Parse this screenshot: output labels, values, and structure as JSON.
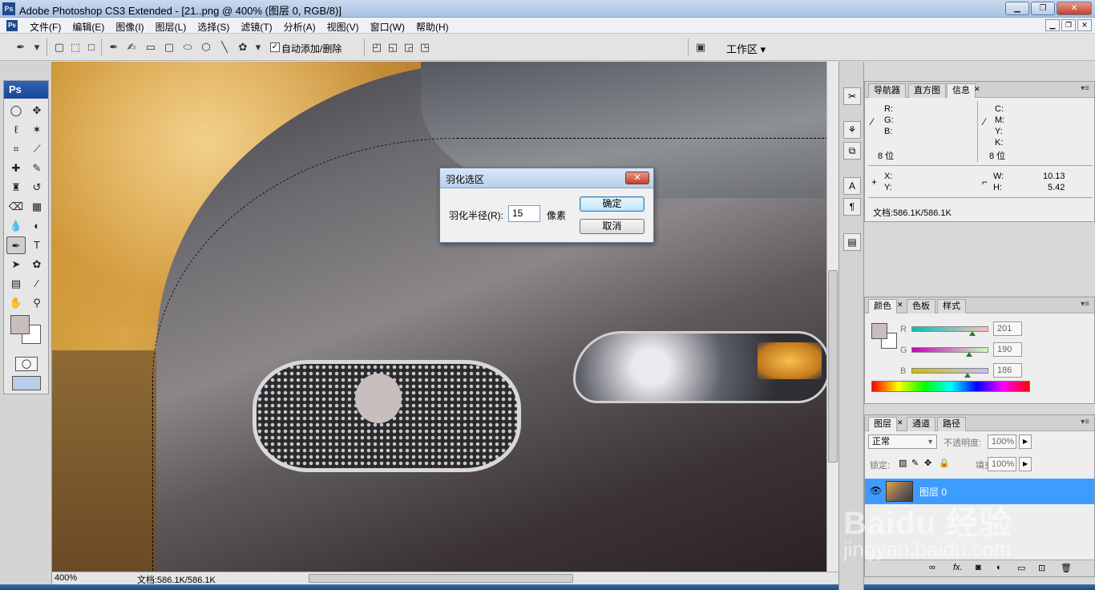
{
  "window": {
    "title": "Adobe Photoshop CS3 Extended - [21..png @ 400% (图层 0, RGB/8)]",
    "app_icon": "Ps",
    "buttons": [
      "minimize",
      "maximize",
      "close"
    ]
  },
  "menu": {
    "items": [
      "文件(F)",
      "编辑(E)",
      "图像(I)",
      "图层(L)",
      "选择(S)",
      "滤镜(T)",
      "分析(A)",
      "视图(V)",
      "窗口(W)",
      "帮助(H)"
    ]
  },
  "options": {
    "auto_add_delete_label": "自动添加/删除",
    "auto_add_delete_checked": true,
    "workspace_label": "工作区 ▾"
  },
  "toolbox": {
    "header": "Ps",
    "foreground_color": "#c9bebe",
    "background_color": "#ffffff"
  },
  "status": {
    "zoom": "400%",
    "doc_info": "文档:586.1K/586.1K"
  },
  "navigator_panel": {
    "tabs": [
      "导航器",
      "直方图",
      "信息"
    ],
    "active_tab": "信息",
    "r_label": "R:",
    "g_label": "G:",
    "b_label": "B:",
    "c_label": "C:",
    "m_label": "M:",
    "y_label": "Y:",
    "k_label": "K:",
    "bits_left": "8 位",
    "bits_right": "8 位",
    "x_label": "X:",
    "y2_label": "Y:",
    "w_label": "W:",
    "h_label": "H:",
    "w_value": "10.13",
    "h_value": "5.42",
    "doc_info": "文档:586.1K/586.1K"
  },
  "color_panel": {
    "tabs": [
      "颜色",
      "色板",
      "样式"
    ],
    "active_tab": "颜色",
    "r_label": "R",
    "g_label": "G",
    "b_label": "B",
    "r_value": "201",
    "g_value": "190",
    "b_value": "186",
    "color_hex": "#c9bebe"
  },
  "layers_panel": {
    "tabs": [
      "图层",
      "通道",
      "路径"
    ],
    "active_tab": "图层",
    "blend_mode": "正常",
    "opacity_label": "不透明度:",
    "opacity_value": "100%",
    "lock_label": "锁定:",
    "fill_label": "填充:",
    "fill_value": "100%",
    "layer_name": "图层 0"
  },
  "dialog": {
    "title": "羽化选区",
    "radius_label": "羽化半径(R):",
    "radius_value": "15",
    "unit": "像素",
    "ok_label": "确定",
    "cancel_label": "取消",
    "close_label": "✕"
  },
  "watermark": {
    "logo": "Baidu 经验",
    "url": "jingyan.baidu.com"
  }
}
